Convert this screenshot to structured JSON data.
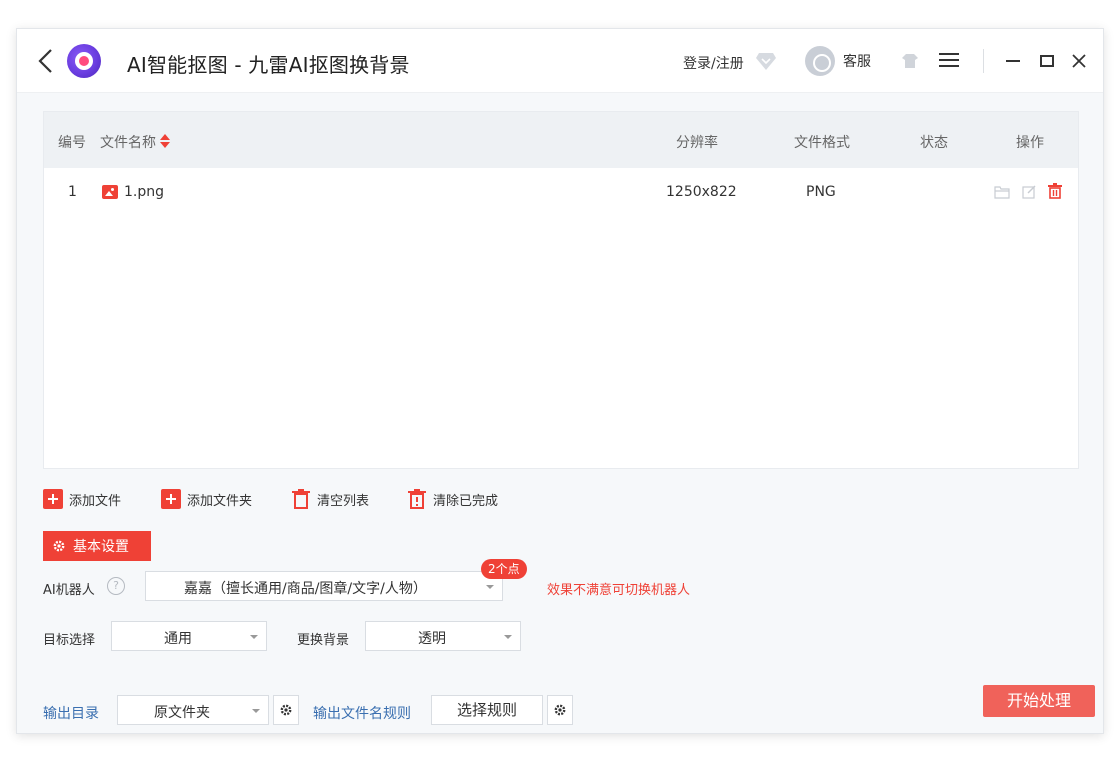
{
  "titlebar": {
    "title": "AI智能抠图 - 九雷AI抠图换背景",
    "login_label": "登录/注册",
    "support_label": "客服",
    "icons": [
      "back-icon",
      "app-logo-icon",
      "vip-icon",
      "support-icon",
      "skin-icon",
      "menu-icon",
      "minimize-icon",
      "maximize-icon",
      "close-icon"
    ]
  },
  "table": {
    "headers": {
      "no": "编号",
      "name": "文件名称",
      "resolution": "分辨率",
      "format": "文件格式",
      "status": "状态",
      "ops": "操作"
    },
    "rows": [
      {
        "no": "1",
        "name": "1.png",
        "resolution": "1250x822",
        "format": "PNG",
        "status": ""
      }
    ]
  },
  "actions": {
    "add_file": "添加文件",
    "add_folder": "添加文件夹",
    "clear_list": "清空列表",
    "clear_done": "清除已完成"
  },
  "settings": {
    "title": "基本设置",
    "robot_label": "AI机器人",
    "help": "?",
    "robot_value": "嘉嘉（擅长通用/商品/图章/文字/人物）",
    "points_badge": "2个点",
    "robot_tip": "效果不满意可切换机器人",
    "target_label": "目标选择",
    "target_value": "通用",
    "bg_label": "更换背景",
    "bg_value": "透明"
  },
  "output": {
    "dir_label": "输出目录",
    "dir_value": "原文件夹",
    "name_rule_label": "输出文件名规则",
    "choose_rule": "选择规则"
  },
  "start_button": "开始处理",
  "colors": {
    "accent": "#ef4136",
    "start_button": "#f0625a",
    "link": "#3a6fb0",
    "logo": "#6a3de0"
  }
}
